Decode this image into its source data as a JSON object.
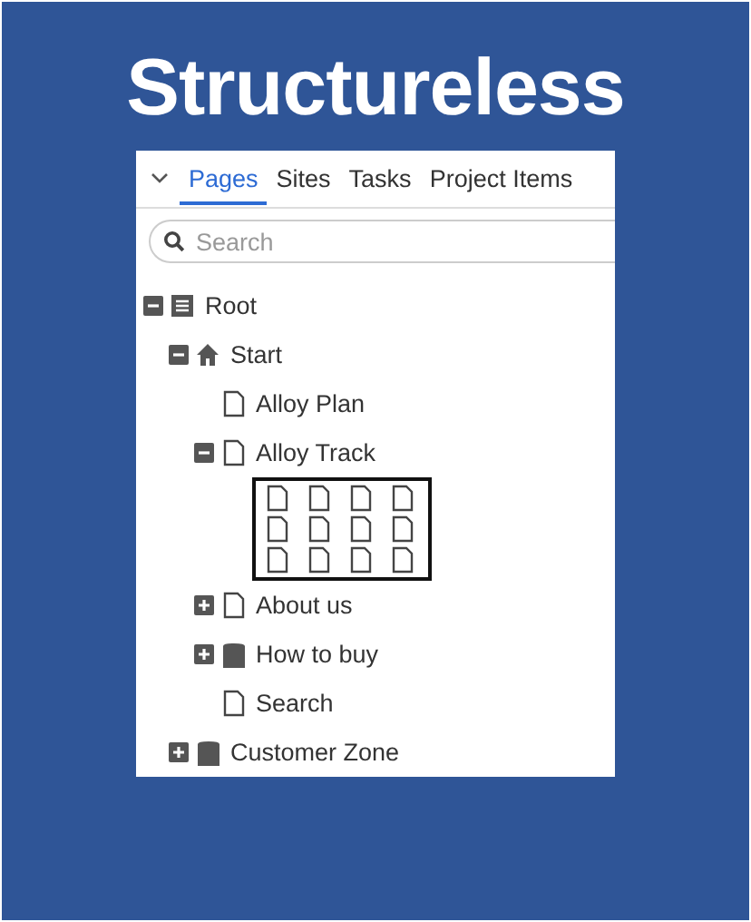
{
  "heading": "Structureless",
  "tabs": [
    {
      "label": "Pages",
      "selected": true
    },
    {
      "label": "Sites",
      "selected": false
    },
    {
      "label": "Tasks",
      "selected": false
    },
    {
      "label": "Project Items",
      "selected": false
    }
  ],
  "search": {
    "placeholder": "Search"
  },
  "tree": [
    {
      "label": "Root",
      "kind": "list",
      "expanded": true,
      "children": [
        {
          "label": "Start",
          "kind": "home",
          "expanded": true,
          "children": [
            {
              "label": "Alloy Plan",
              "kind": "page"
            },
            {
              "label": "Alloy Track",
              "kind": "page",
              "expanded": true,
              "grid": [
                {
                  "kind": "page"
                },
                {
                  "kind": "page"
                },
                {
                  "kind": "page"
                },
                {
                  "kind": "page"
                },
                {
                  "kind": "page"
                },
                {
                  "kind": "page"
                },
                {
                  "kind": "page"
                },
                {
                  "kind": "page"
                },
                {
                  "kind": "page"
                },
                {
                  "kind": "page"
                },
                {
                  "kind": "page"
                },
                {
                  "kind": "page"
                }
              ]
            },
            {
              "label": "About us",
              "kind": "page",
              "expanded": false
            },
            {
              "label": "How to buy",
              "kind": "folder",
              "expanded": false
            },
            {
              "label": "Search",
              "kind": "page"
            }
          ]
        },
        {
          "label": "Customer Zone",
          "kind": "folder",
          "expanded": false
        }
      ]
    }
  ]
}
